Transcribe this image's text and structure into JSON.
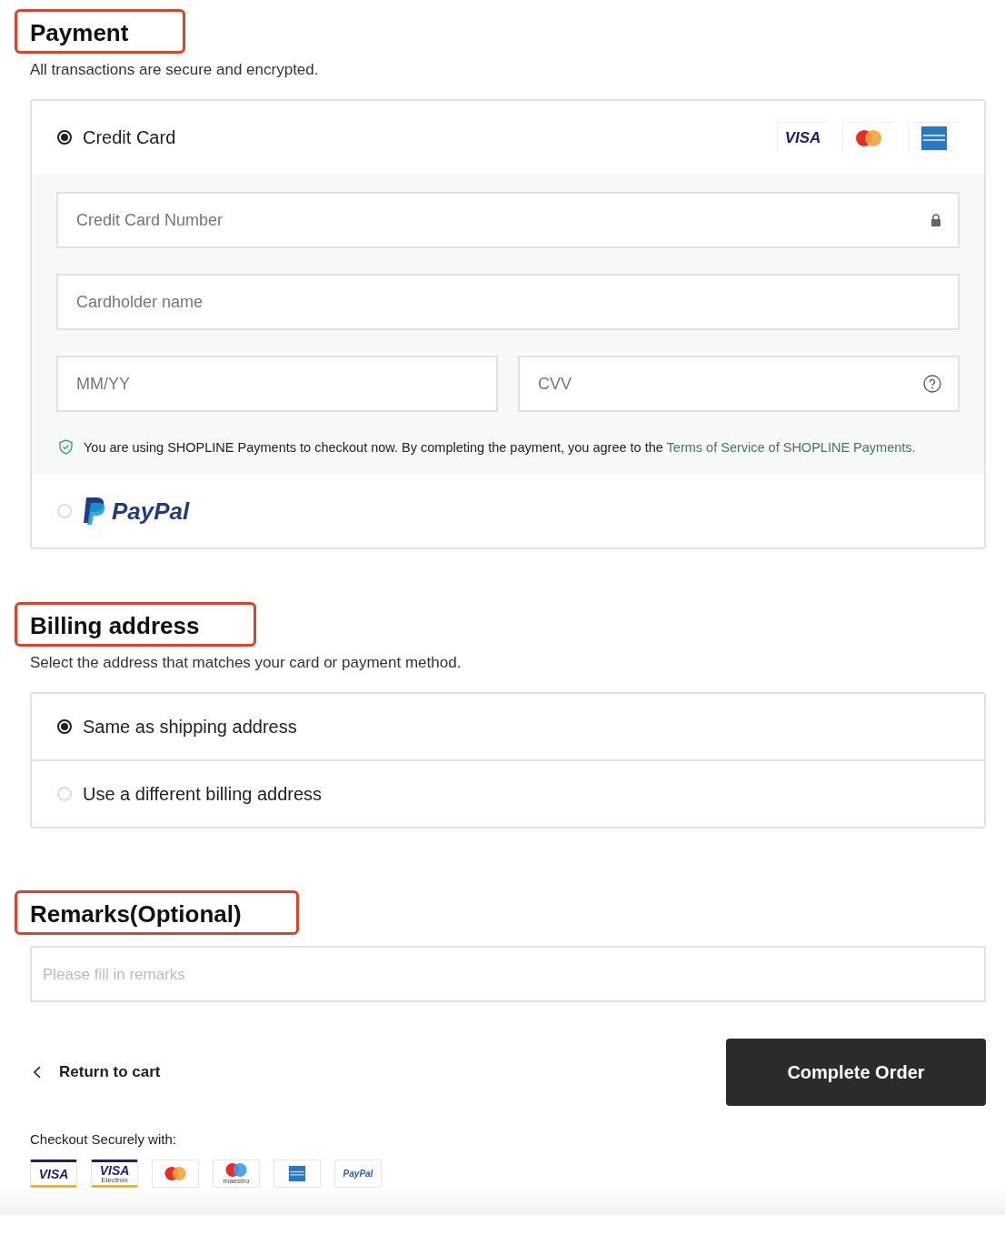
{
  "payment": {
    "heading": "Payment",
    "highlighted": true,
    "subtitle": "All transactions are secure and encrypted.",
    "methods": [
      {
        "kind": "card",
        "label": "Credit Card",
        "selected": true,
        "logos": [
          {
            "kind": "visa",
            "label": "VISA"
          },
          {
            "kind": "mastercard"
          },
          {
            "kind": "amex"
          }
        ],
        "fields": [
          {
            "kind": "number",
            "placeholder": "Credit Card Number"
          },
          {
            "kind": "name",
            "placeholder": "Cardholder name"
          },
          {
            "kind": "expiry",
            "placeholder": "MM/YY"
          },
          {
            "kind": "cvv",
            "placeholder": "CVV"
          }
        ],
        "notice": "You are using SHOPLINE Payments to checkout now. By completing the payment, you agree to the",
        "notice_link": "Terms of Service of SHOPLINE Payments."
      },
      {
        "kind": "paypal",
        "label": "PayPal",
        "selected": false
      }
    ]
  },
  "billing": {
    "heading": "Billing address",
    "highlighted": true,
    "subtitle": "Select the address that matches your card or payment method.",
    "options": [
      {
        "label": "Same as shipping address",
        "selected": true
      },
      {
        "label": "Use a different billing address",
        "selected": false
      }
    ]
  },
  "remarks": {
    "heading": "Remarks(Optional)",
    "highlighted": true,
    "placeholder": "Please fill in remarks"
  },
  "actions": {
    "back": "Return to cart",
    "submit": "Complete Order"
  },
  "footer": {
    "title": "Checkout Securely with:",
    "logos": [
      {
        "kind": "visa",
        "label": "VISA"
      },
      {
        "kind": "visa-electron",
        "label": "VISA",
        "sublabel": "Electron"
      },
      {
        "kind": "mastercard"
      },
      {
        "kind": "maestro",
        "sublabel": "maestro"
      },
      {
        "kind": "amex"
      },
      {
        "kind": "paypal",
        "label": "PayPal"
      }
    ]
  }
}
